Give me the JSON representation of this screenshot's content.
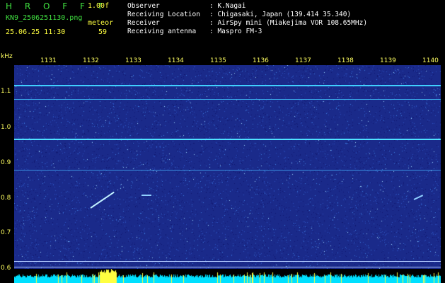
{
  "header": {
    "title": "H R O F F T",
    "version": "1.00f",
    "filename": "KN9_2506251130.png",
    "meteor_label": "meteor",
    "datetime": "25.06.25 11:30",
    "meteor_count": "59"
  },
  "info": {
    "rows": [
      {
        "label": "Observer",
        "value": ": K.Nagai"
      },
      {
        "label": "Receiving Location",
        "value": ": Chigasaki, Japan (139.414 35.340)"
      },
      {
        "label": "Receiver",
        "value": ": AirSpy mini (Miakejima VOR 108.65MHz)"
      },
      {
        "label": "Receiving antenna",
        "value": ": Maspro FM-3"
      }
    ]
  },
  "axis": {
    "y_unit": "kHz",
    "y_ticks": [
      "1.1",
      "1.0",
      "0.9",
      "0.8",
      "0.7",
      "0.6"
    ],
    "x_ticks": [
      "1131",
      "1132",
      "1133",
      "1134",
      "1135",
      "1136",
      "1137",
      "1138",
      "1139",
      "1140"
    ]
  },
  "colors": {
    "background": "#1a2a8a",
    "signal_line": "#40d0ff",
    "bottom_bar": "#00e0ff",
    "bottom_peak": "#ffff40"
  }
}
